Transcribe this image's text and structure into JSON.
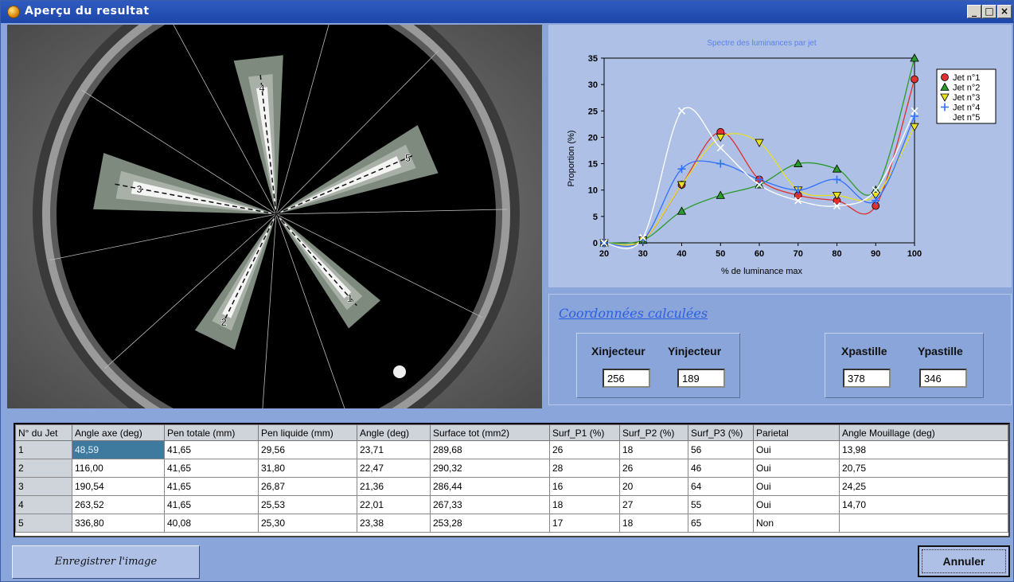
{
  "window": {
    "title": "Aperçu du resultat",
    "minimize": "_",
    "maximize": "□",
    "close": "×"
  },
  "image": {
    "jet_labels": [
      "1",
      "2",
      "3",
      "4",
      "5"
    ]
  },
  "chart_data": {
    "type": "scatter",
    "title": "Spectre des luminances par jet",
    "xlabel": "% de luminance max",
    "ylabel": "Proportion (%)",
    "xlim": [
      20,
      100
    ],
    "ylim": [
      0,
      35
    ],
    "xticks": [
      20,
      30,
      40,
      50,
      60,
      70,
      80,
      90,
      100
    ],
    "yticks": [
      0,
      5,
      10,
      15,
      20,
      25,
      30,
      35
    ],
    "legend_position": "top-right",
    "x": [
      20,
      30,
      40,
      50,
      60,
      70,
      80,
      90,
      100
    ],
    "series": [
      {
        "name": "Jet n°1",
        "marker": "circle",
        "color": "#e03030",
        "values": [
          0,
          0.5,
          11,
          21,
          12,
          9,
          8,
          7,
          31
        ]
      },
      {
        "name": "Jet n°2",
        "marker": "triangle-up",
        "color": "#2a9a2a",
        "values": [
          0,
          0.5,
          6,
          9,
          11,
          15,
          14,
          10,
          35
        ]
      },
      {
        "name": "Jet n°3",
        "marker": "triangle-down",
        "color": "#e8e020",
        "values": [
          0,
          0.5,
          11,
          20,
          19,
          10,
          9,
          9,
          22
        ]
      },
      {
        "name": "Jet n°4",
        "marker": "plus",
        "color": "#3070ff",
        "values": [
          0,
          0.5,
          14,
          15,
          12,
          10,
          12,
          8,
          24
        ]
      },
      {
        "name": "Jet n°5",
        "marker": "x",
        "color": "#ffffff",
        "values": [
          0,
          1,
          25,
          18,
          11,
          8,
          7,
          10,
          25
        ]
      }
    ]
  },
  "coords": {
    "title": "Coordonnées calculées",
    "xinjecteur_label": "Xinjecteur",
    "xinjecteur_value": "256",
    "yinjecteur_label": "Yinjecteur",
    "yinjecteur_value": "189",
    "xpastille_label": "Xpastille",
    "xpastille_value": "378",
    "ypastille_label": "Ypastille",
    "ypastille_value": "346"
  },
  "table": {
    "headers": [
      "N° du Jet",
      "Angle axe (deg)",
      "Pen totale (mm)",
      "Pen liquide (mm)",
      "Angle (deg)",
      "Surface tot (mm2)",
      "Surf_P1 (%)",
      "Surf_P2 (%)",
      "Surf_P3 (%)",
      "Parietal",
      "Angle Mouillage (deg)"
    ],
    "rows": [
      [
        "1",
        "48,59",
        "41,65",
        "29,56",
        "23,71",
        "289,68",
        "26",
        "18",
        "56",
        "Oui",
        "13,98"
      ],
      [
        "2",
        "116,00",
        "41,65",
        "31,80",
        "22,47",
        "290,32",
        "28",
        "26",
        "46",
        "Oui",
        "20,75"
      ],
      [
        "3",
        "190,54",
        "41,65",
        "26,87",
        "21,36",
        "286,44",
        "16",
        "20",
        "64",
        "Oui",
        "24,25"
      ],
      [
        "4",
        "263,52",
        "41,65",
        "25,53",
        "22,01",
        "267,33",
        "18",
        "27",
        "55",
        "Oui",
        "14,70"
      ],
      [
        "5",
        "336,80",
        "40,08",
        "25,30",
        "23,38",
        "253,28",
        "17",
        "18",
        "65",
        "Non",
        ""
      ]
    ]
  },
  "buttons": {
    "save": "Enregistrer l'image",
    "cancel": "Annuler"
  }
}
